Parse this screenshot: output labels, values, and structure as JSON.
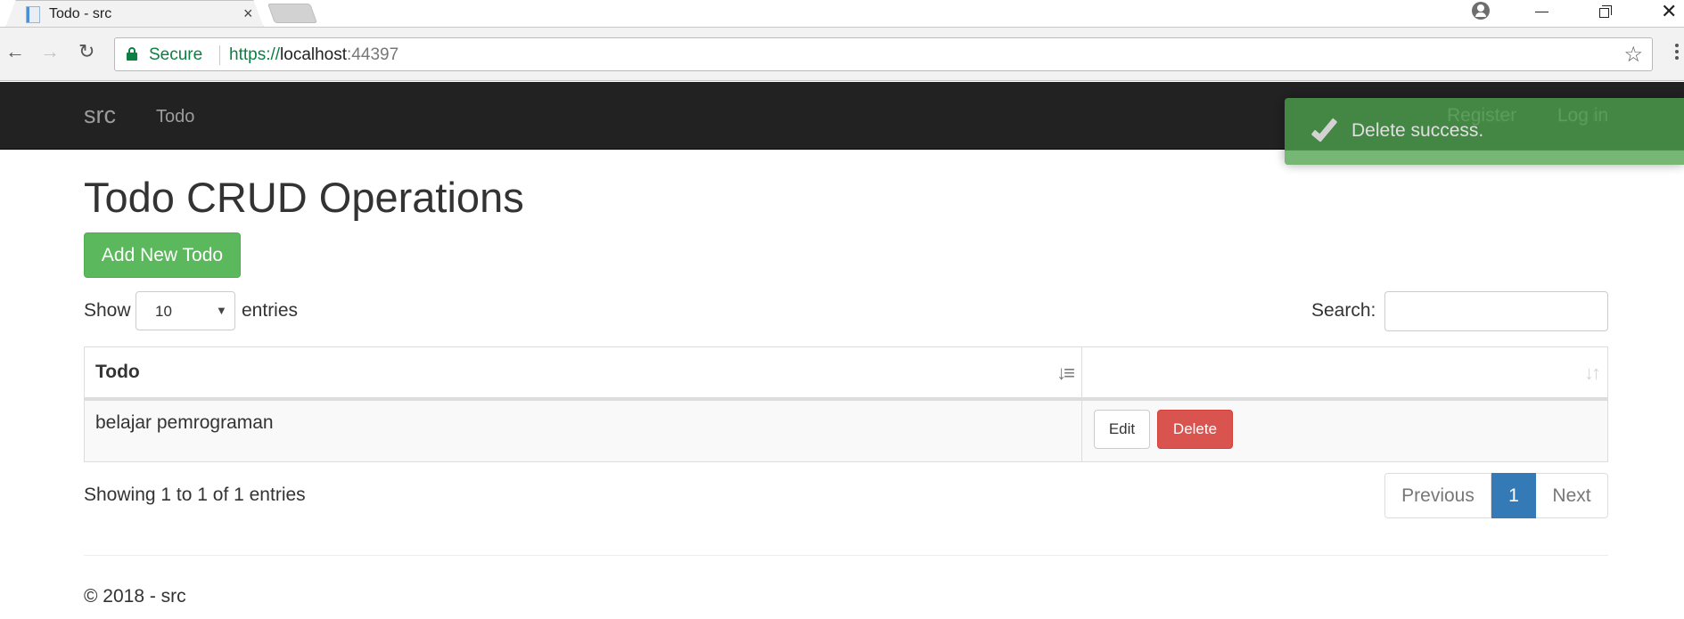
{
  "browser": {
    "tab_title": "Todo - src",
    "tab_close": "×",
    "secure_label": "Secure",
    "url_scheme": "https://",
    "url_host": "localhost",
    "url_port": ":44397",
    "icons": {
      "back": "←",
      "forward": "→",
      "reload": "↻",
      "star": "☆",
      "close": "✕"
    }
  },
  "navbar": {
    "brand": "src",
    "links": {
      "todo": "Todo",
      "register": "Register",
      "login": "Log in"
    }
  },
  "main": {
    "title": "Todo CRUD Operations",
    "add_button": "Add New Todo",
    "length": {
      "show_label": "Show",
      "selected": "10",
      "entries_label": "entries",
      "caret": "▼"
    },
    "search": {
      "label": "Search:",
      "value": "",
      "placeholder": ""
    },
    "table": {
      "columns": [
        {
          "label": "Todo",
          "sort": "ascending",
          "sort_icon": "↓≡"
        },
        {
          "label": "",
          "sort": "none",
          "sort_icon": "↓↑"
        }
      ],
      "rows": [
        {
          "todo": "belajar pemrograman",
          "edit_label": "Edit",
          "delete_label": "Delete"
        }
      ]
    },
    "info": "Showing 1 to 1 of 1 entries",
    "pagination": {
      "previous": "Previous",
      "current": "1",
      "next": "Next"
    }
  },
  "footer": {
    "text": "© 2018 - src"
  },
  "toast": {
    "type": "success",
    "message": "Delete success.",
    "color": "#468a46"
  },
  "colors": {
    "navbar_bg": "#222222",
    "success": "#5cb85c",
    "danger": "#d9534f",
    "primary": "#337ab7",
    "secure_green": "#0b8043"
  }
}
